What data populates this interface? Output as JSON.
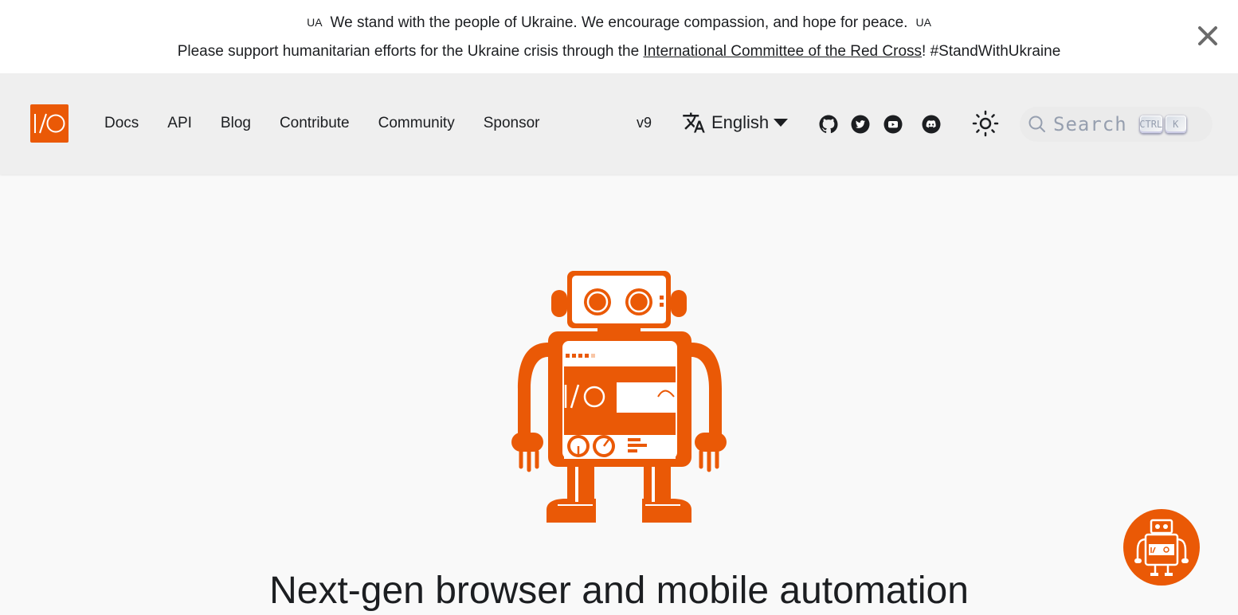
{
  "announcement": {
    "flag_left": "UA",
    "message": "We stand with the people of Ukraine. We encourage compassion, and hope for peace.",
    "flag_right": "UA",
    "support_prefix": "Please support humanitarian efforts for the Ukraine crisis through the ",
    "support_link": "International Committee of the Red Cross",
    "support_suffix": "! #StandWithUkraine",
    "close_icon": "close-icon"
  },
  "navbar": {
    "logo_icon": "webdriverio-logo",
    "links": [
      "Docs",
      "API",
      "Blog",
      "Contribute",
      "Community",
      "Sponsor"
    ],
    "version": "v9",
    "language": "English",
    "social_icons": [
      "github-icon",
      "twitter-icon",
      "youtube-icon",
      "discord-icon"
    ],
    "theme_icon": "sun-icon",
    "search": {
      "placeholder": "Search",
      "key_ctrl": "CTRL",
      "key_k": "K"
    }
  },
  "hero": {
    "headline": "Next-gen browser and mobile automation"
  },
  "colors": {
    "brand": "#ea5906",
    "navbar_bg": "#efefef",
    "page_bg": "#f9f9f9"
  }
}
